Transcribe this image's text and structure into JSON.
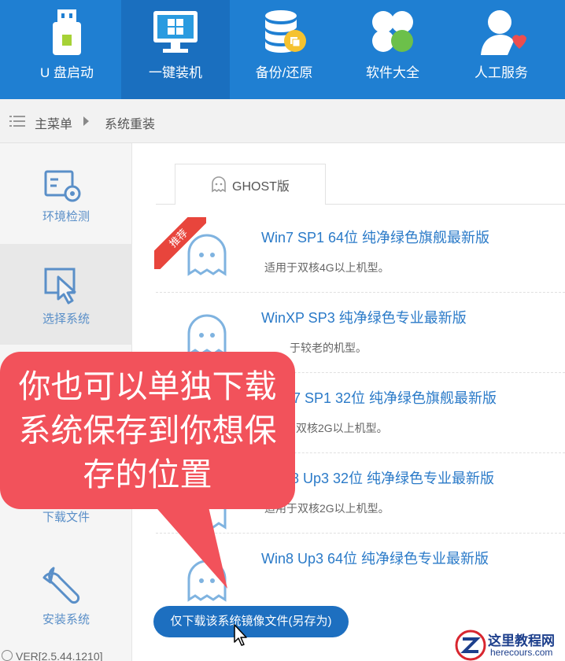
{
  "nav": {
    "items": [
      {
        "label": "U 盘启动",
        "icon": "usb-drive-icon"
      },
      {
        "label": "一键装机",
        "icon": "monitor-windows-icon"
      },
      {
        "label": "备份/还原",
        "icon": "database-backup-icon"
      },
      {
        "label": "软件大全",
        "icon": "apps-clover-icon"
      },
      {
        "label": "人工服务",
        "icon": "support-person-icon"
      }
    ],
    "active_index": 1
  },
  "breadcrumb": {
    "root": "主菜单",
    "current": "系统重装"
  },
  "sidebar": {
    "items": [
      {
        "label": "环境检测",
        "icon": "environment-check-icon"
      },
      {
        "label": "选择系统",
        "icon": "select-system-icon"
      },
      {
        "label": "下载文件",
        "icon": "download-file-icon"
      },
      {
        "label": "安装系统",
        "icon": "install-wrench-icon"
      }
    ],
    "active_index": 1
  },
  "tab": {
    "label": "GHOST版"
  },
  "ribbon": {
    "label": "推荐"
  },
  "systems": [
    {
      "title": "Win7 SP1 64位 纯净绿色旗舰最新版",
      "desc": "适用于双核4G以上机型。"
    },
    {
      "title": "WinXP SP3 纯净绿色专业最新版",
      "desc": "于较老的机型。"
    },
    {
      "title": "7 SP1 32位 纯净绿色旗舰最新版",
      "desc": "双核2G以上机型。"
    },
    {
      "title": "8 Up3 32位 纯净绿色专业最新版",
      "desc": "适用于双核2G以上机型。"
    },
    {
      "title": "Win8 Up3 64位 纯净绿色专业最新版",
      "desc": ""
    }
  ],
  "callout": {
    "lines": [
      "你也可以单独下载",
      "系统保存到你想保",
      "存的位置"
    ]
  },
  "download_button": {
    "label": "仅下载该系统镜像文件(另存为)"
  },
  "version": {
    "text": "VER[2.5.44.1210]"
  },
  "watermark": {
    "line1": "这里教程网",
    "line2": "herecours.com"
  },
  "colors": {
    "nav_bg": "#1f7fd2",
    "accent_blue": "#2a7ac8",
    "callout_red": "#f2525b",
    "ribbon_red": "#e8453c"
  }
}
